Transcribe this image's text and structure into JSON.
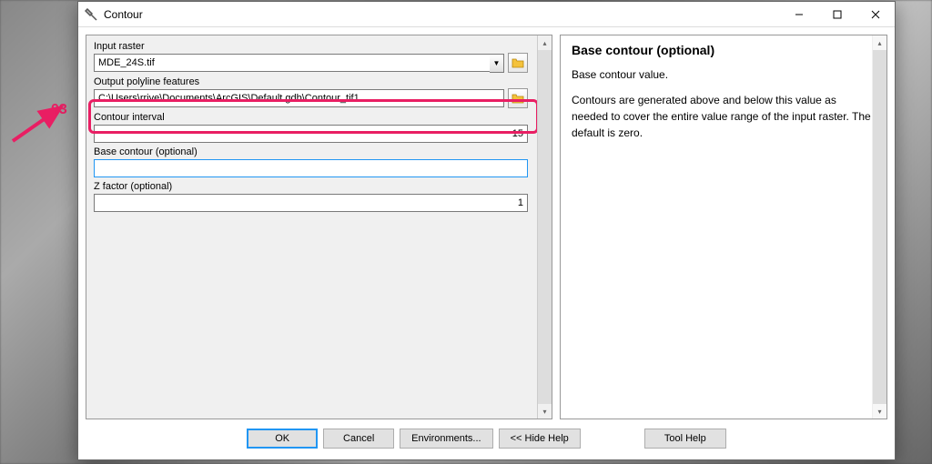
{
  "window": {
    "title": "Contour"
  },
  "fields": {
    "input_raster": {
      "label": "Input raster",
      "value": "MDE_24S.tif"
    },
    "output_poly": {
      "label": "Output polyline features",
      "value": "C:\\Users\\rrive\\Documents\\ArcGIS\\Default.gdb\\Contour_tif1"
    },
    "contour_int": {
      "label": "Contour interval",
      "value": "15"
    },
    "base_contour": {
      "label": "Base contour (optional)",
      "value": ""
    },
    "z_factor": {
      "label": "Z factor (optional)",
      "value": "1"
    }
  },
  "help": {
    "title": "Base contour (optional)",
    "p1": "Base contour value.",
    "p2": "Contours are generated above and below this value as needed to cover the entire value range of the input raster. The default is zero."
  },
  "buttons": {
    "ok": "OK",
    "cancel": "Cancel",
    "env": "Environments...",
    "hide": "<< Hide Help",
    "toolhelp": "Tool Help"
  },
  "annotation": {
    "num": "03"
  }
}
